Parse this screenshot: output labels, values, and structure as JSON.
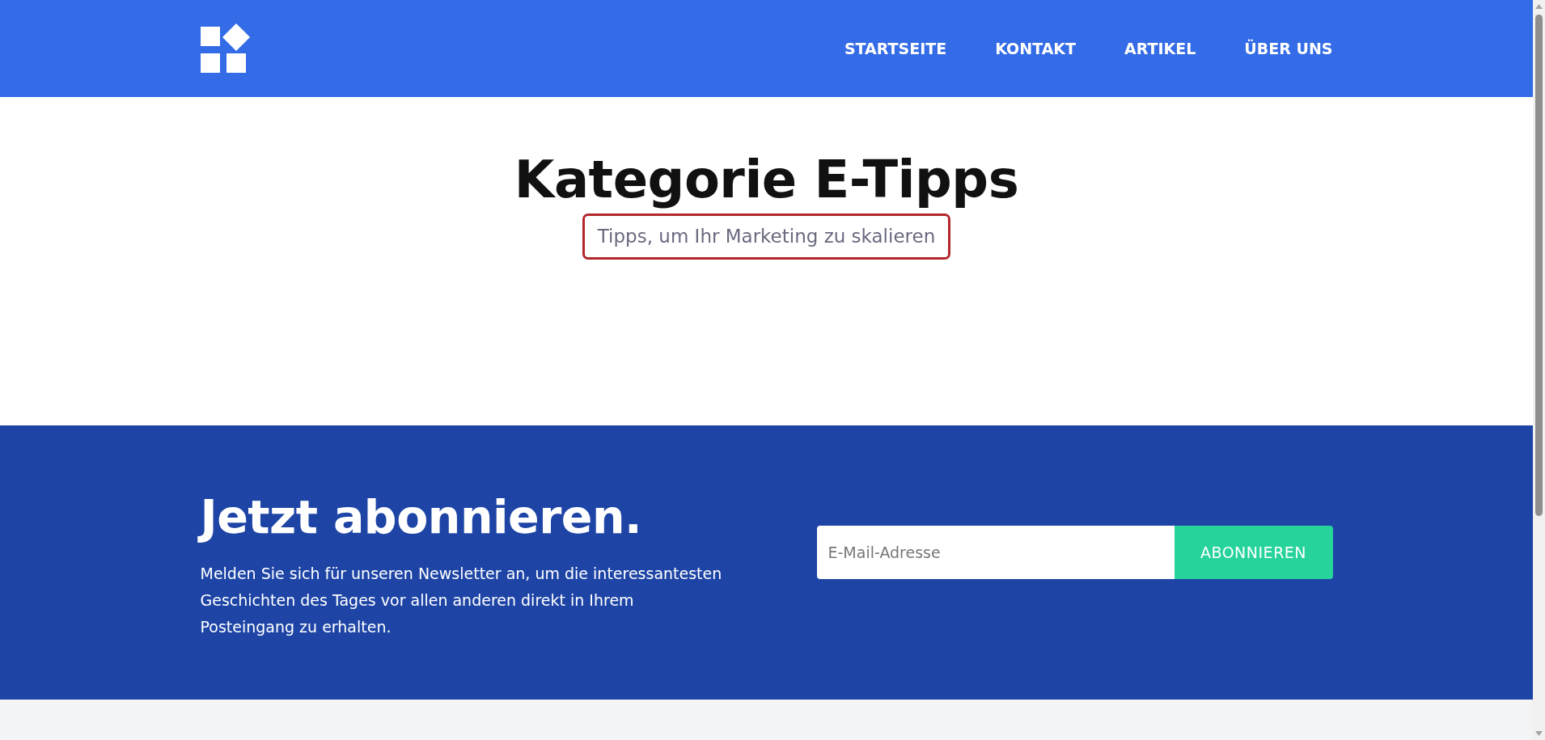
{
  "header": {
    "nav": [
      {
        "label": "STARTSEITE"
      },
      {
        "label": "KONTAKT"
      },
      {
        "label": "ARTIKEL"
      },
      {
        "label": "ÜBER UNS"
      }
    ]
  },
  "hero": {
    "title": "Kategorie E-Tipps",
    "subtitle": {
      "text": "Tipps, um Ihr Marketing zu skalieren",
      "highlighted": true
    }
  },
  "newsletter": {
    "title": "Jetzt abonnieren.",
    "text": "Melden Sie sich für unseren Newsletter an, um die interessantesten Geschichten des Tages vor allen anderen direkt in Ihrem Posteingang zu erhalten.",
    "email_field": {
      "placeholder": "E-Mail-Adresse"
    },
    "button": "ABONNIEREN"
  }
}
